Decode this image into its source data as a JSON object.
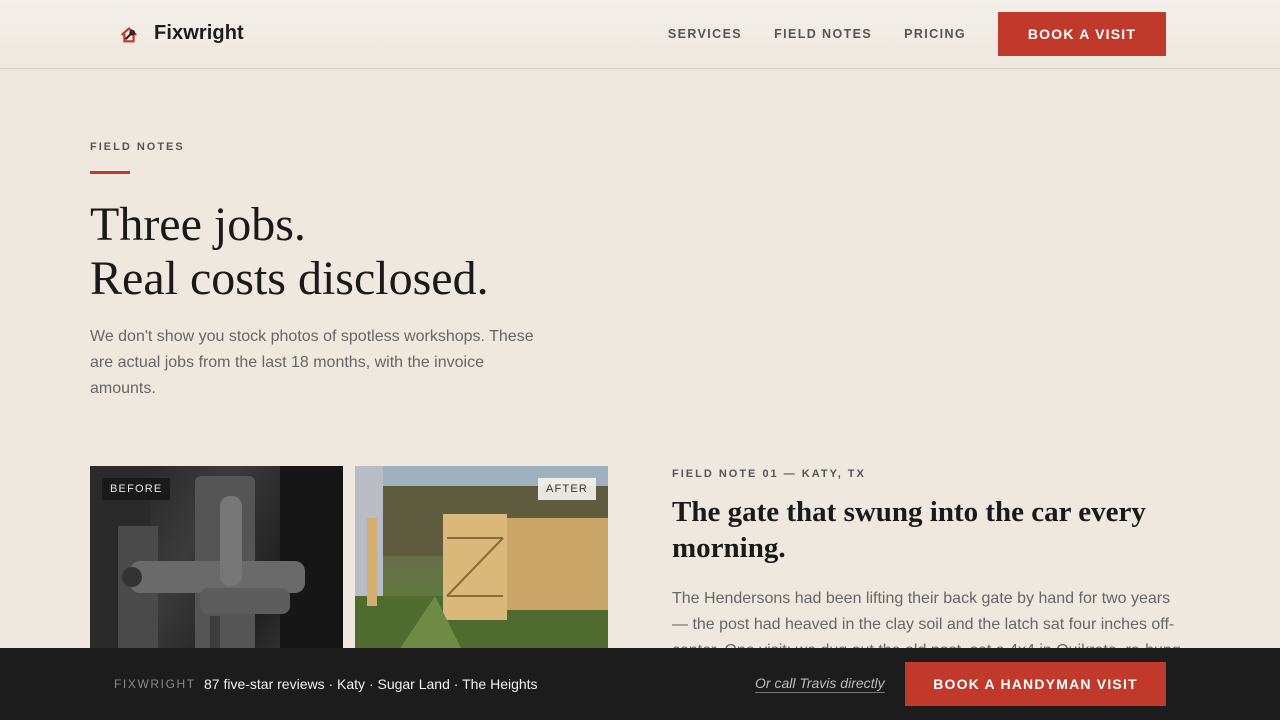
{
  "header": {
    "brand_name": "Fixwright",
    "nav": [
      {
        "label": "SERVICES"
      },
      {
        "label": "FIELD NOTES"
      },
      {
        "label": "PRICING"
      }
    ],
    "cta_label": "BOOK A VISIT"
  },
  "intro": {
    "eyebrow": "FIELD NOTES",
    "headline_line1": "Three jobs.",
    "headline_line2": "Real costs disclosed.",
    "paragraph": "We don't show you stock photos of spotless workshops. These are actual jobs from the last 18 months, with the invoice amounts."
  },
  "field_note": {
    "photo_before_tag": "BEFORE",
    "photo_after_tag": "AFTER",
    "eyebrow": "FIELD NOTE 01 — KATY, TX",
    "title": "The gate that swung into the car every morning.",
    "body": "The Hendersons had been lifting their back gate by hand for two years — the post had heaved in the clay soil and the latch sat four inches off-center. One visit: we dug out the old post, set a 4x4 in Quikrete, re-hung"
  },
  "sticky_bar": {
    "brand": "FIXWRIGHT",
    "reviews": "87 five-star reviews · Katy · Sugar Land · The Heights",
    "call_link": "Or call Travis directly",
    "cta_label": "BOOK A HANDYMAN VISIT"
  },
  "colors": {
    "accent": "#c0392b",
    "background": "#efe8df",
    "sticky_bg": "#1c1c1c"
  }
}
